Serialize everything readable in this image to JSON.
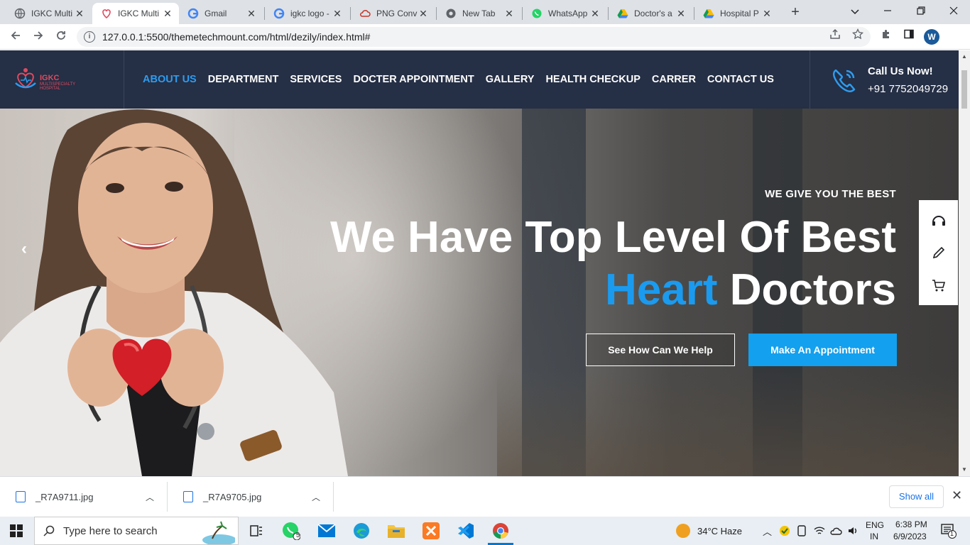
{
  "browser": {
    "tabs": [
      {
        "title": "IGKC Multi",
        "icon": "globe-icon",
        "active": false
      },
      {
        "title": "IGKC Multi",
        "icon": "igkc-favicon",
        "active": true
      },
      {
        "title": "Gmail",
        "icon": "google-icon",
        "active": false
      },
      {
        "title": "igkc logo -",
        "icon": "google-icon",
        "active": false
      },
      {
        "title": "PNG Conv",
        "icon": "cloud-convert-icon",
        "active": false
      },
      {
        "title": "New Tab",
        "icon": "chrome-icon",
        "active": false
      },
      {
        "title": "WhatsApp",
        "icon": "whatsapp-icon",
        "active": false
      },
      {
        "title": "Doctor's a",
        "icon": "google-drive-icon",
        "active": false
      },
      {
        "title": "Hospital P",
        "icon": "google-drive-icon",
        "active": false
      }
    ],
    "close_glyph": "✕",
    "new_tab_glyph": "+",
    "url": "127.0.0.1:5500/themetechmount.com/html/dezily/index.html#",
    "profile_initial": "W"
  },
  "site": {
    "logo": {
      "name": "IGKC",
      "subtitle": "MULTISPECIALTY HOSPITAL"
    },
    "nav": [
      {
        "label": "ABOUT US",
        "active": true
      },
      {
        "label": "DEPARTMENT",
        "active": false
      },
      {
        "label": "SERVICES",
        "active": false
      },
      {
        "label": "DOCTER APPOINTMENT",
        "active": false
      },
      {
        "label": "GALLERY",
        "active": false
      },
      {
        "label": "HEALTH CHECKUP",
        "active": false
      },
      {
        "label": "CARRER",
        "active": false
      },
      {
        "label": "CONTACT US",
        "active": false
      }
    ],
    "call": {
      "title": "Call Us Now!",
      "number": "+91 7752049729"
    },
    "hero": {
      "kicker": "WE GIVE YOU THE BEST",
      "title_line1": "We Have Top Level Of Best",
      "title_accent": "Heart",
      "title_rest": "Doctors",
      "btn_help": "See How Can We Help",
      "btn_appointment": "Make An Appointment",
      "prev_glyph": "‹"
    },
    "side_tools": [
      "headset-icon",
      "pencil-icon",
      "cart-icon"
    ],
    "accent_color": "#1a9bf0",
    "header_bg": "#252f45"
  },
  "downloads": {
    "files": [
      "_R7A9711.jpg",
      "_R7A9705.jpg"
    ],
    "show_all": "Show all"
  },
  "taskbar": {
    "search_placeholder": "Type here to search",
    "whatsapp_badge": "5",
    "weather": "34°C  Haze",
    "lang_top": "ENG",
    "lang_bottom": "IN",
    "time": "6:38 PM",
    "date": "6/9/2023",
    "notif_count": "1"
  }
}
